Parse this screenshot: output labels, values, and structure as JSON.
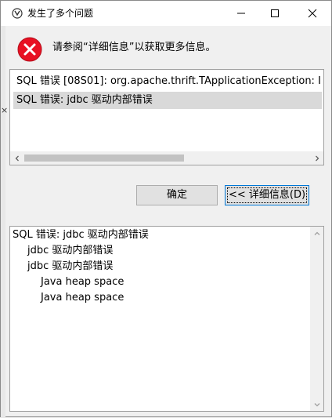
{
  "window": {
    "title": "发生了多个问题"
  },
  "message": {
    "text": "请参阅“详细信息”以获取更多信息。"
  },
  "list": {
    "items": [
      "SQL 错误 [08S01]: org.apache.thrift.TApplicationException: I",
      "SQL 错误: jdbc 驱动内部错误"
    ],
    "selected_index": 1
  },
  "buttons": {
    "ok_label": "确定",
    "details_label": "<< 详细信息(D)"
  },
  "details": {
    "lines": [
      "SQL 错误: jdbc 驱动内部错误",
      "jdbc 驱动内部错误",
      "jdbc 驱动内部错误",
      "Java heap space",
      "Java heap space"
    ]
  },
  "colors": {
    "error_red": "#e81123",
    "selection": "#d9d9d9",
    "focus_border": "#0078d7"
  },
  "icons": {
    "app": "app-icon",
    "error": "error-icon",
    "minimize": "minimize-icon",
    "maximize": "maximize-icon",
    "close": "close-icon"
  }
}
